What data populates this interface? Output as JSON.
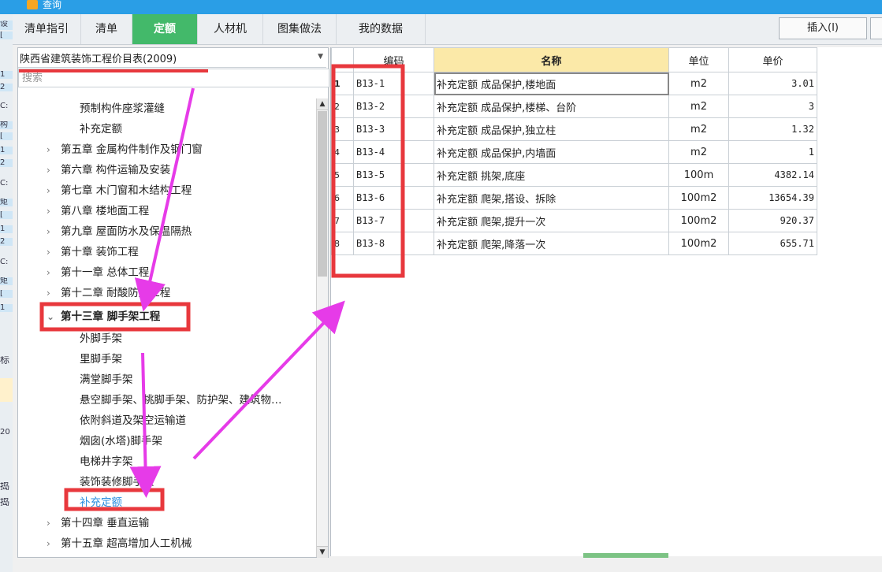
{
  "window": {
    "title": "查询"
  },
  "background_window": {
    "cells": [
      "设",
      "[",
      "1",
      "2",
      "C:",
      "构",
      "[",
      "1",
      "2",
      "C:",
      "矩",
      "[",
      "1",
      "2",
      "C:",
      "矩",
      "[",
      "1",
      "标",
      "20",
      "捣",
      "捣"
    ]
  },
  "tabs": [
    {
      "label": "清单指引"
    },
    {
      "label": "清单"
    },
    {
      "label": "定额"
    },
    {
      "label": "人材机"
    },
    {
      "label": "图集做法"
    },
    {
      "label": "我的数据"
    }
  ],
  "toolbar": {
    "insert_label": "插入(I)"
  },
  "library": {
    "selected": "陕西省建筑装饰工程价目表(2009)"
  },
  "search": {
    "placeholder": "搜索"
  },
  "tree": [
    {
      "label": "预制构件座浆灌缝"
    },
    {
      "label": "补充定额"
    },
    {
      "label": "第五章 金属构件制作及钢门窗"
    },
    {
      "label": "第六章 构件运输及安装"
    },
    {
      "label": "第七章 木门窗和木结构工程"
    },
    {
      "label": "第八章 楼地面工程"
    },
    {
      "label": "第九章 屋面防水及保温隔热"
    },
    {
      "label": "第十章 装饰工程"
    },
    {
      "label": "第十一章 总体工程"
    },
    {
      "label": "第十二章 耐酸防腐工程"
    },
    {
      "label": "第十三章 脚手架工程"
    },
    {
      "label": "外脚手架"
    },
    {
      "label": "里脚手架"
    },
    {
      "label": "满堂脚手架"
    },
    {
      "label": "悬空脚手架、挑脚手架、防护架、建筑物…"
    },
    {
      "label": "依附斜道及架空运输道"
    },
    {
      "label": "烟囱(水塔)脚手架"
    },
    {
      "label": "电梯井字架"
    },
    {
      "label": "装饰装修脚手架"
    },
    {
      "label": "补充定额"
    },
    {
      "label": "第十四章 垂直运输"
    },
    {
      "label": "第十五章 超高增加人工机械"
    }
  ],
  "grid": {
    "headers": [
      "编码",
      "名称",
      "单位",
      "单价"
    ],
    "rows": [
      {
        "index": "1",
        "code": "B13-1",
        "name": "补充定额 成品保护,楼地面",
        "unit": "m2",
        "price": "3.01"
      },
      {
        "index": "2",
        "code": "B13-2",
        "name": "补充定额 成品保护,楼梯、台阶",
        "unit": "m2",
        "price": "3"
      },
      {
        "index": "3",
        "code": "B13-3",
        "name": "补充定额 成品保护,独立柱",
        "unit": "m2",
        "price": "1.32"
      },
      {
        "index": "4",
        "code": "B13-4",
        "name": "补充定额 成品保护,内墙面",
        "unit": "m2",
        "price": "1"
      },
      {
        "index": "5",
        "code": "B13-5",
        "name": "补充定额 挑架,底座",
        "unit": "100m",
        "price": "4382.14"
      },
      {
        "index": "6",
        "code": "B13-6",
        "name": "补充定额 爬架,搭设、拆除",
        "unit": "100m2",
        "price": "13654.39"
      },
      {
        "index": "7",
        "code": "B13-7",
        "name": "补充定额 爬架,提升一次",
        "unit": "100m2",
        "price": "920.37"
      },
      {
        "index": "8",
        "code": "B13-8",
        "name": "补充定额 爬架,降落一次",
        "unit": "100m2",
        "price": "655.71"
      }
    ]
  },
  "colors": {
    "active_tab": "#43b96a",
    "title_bar": "#2a9ee6",
    "annotation_box": "#e8383d",
    "annotation_arrow": "#e63be8",
    "selected_node": "#2b8fe0",
    "sorted_header": "#fbe9a8"
  },
  "icons": {
    "app": "app-logo-icon",
    "dropdown": "chevron-down-icon",
    "collapsed": "chevron-right-icon",
    "expanded": "chevron-down-icon"
  }
}
